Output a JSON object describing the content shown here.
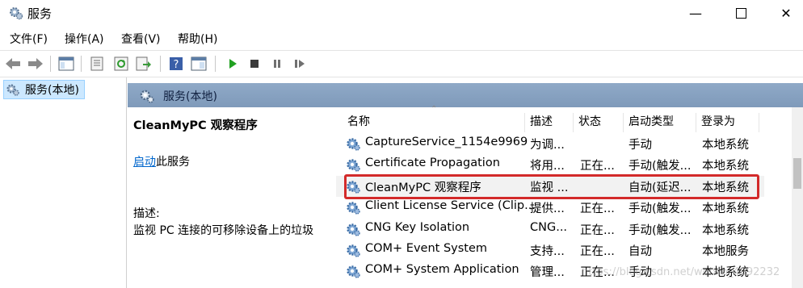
{
  "window": {
    "title": "服务"
  },
  "menu": [
    "文件(F)",
    "操作(A)",
    "查看(V)",
    "帮助(H)"
  ],
  "toolbar_icons": [
    "back-icon",
    "forward-icon",
    "show-hide-tree-icon",
    "properties-icon",
    "refresh-icon",
    "export-list-icon",
    "help-icon",
    "view-icon",
    "start-service-icon",
    "stop-service-icon",
    "pause-service-icon",
    "restart-service-icon"
  ],
  "tree": {
    "root": "服务(本地)"
  },
  "pane": {
    "header": "服务(本地)",
    "selected_name": "CleanMyPC 观察程序",
    "start_link": "启动",
    "start_suffix": "此服务",
    "desc_label": "描述:",
    "desc_text": "监视 PC 连接的可移除设备上的垃圾"
  },
  "columns": {
    "name": "名称",
    "desc": "描述",
    "status": "状态",
    "startup": "启动类型",
    "logon": "登录为"
  },
  "rows": [
    {
      "name": "CaptureService_1154e9969",
      "desc": "为调...",
      "status": "",
      "startup": "手动",
      "logon": "本地系统"
    },
    {
      "name": "Certificate Propagation",
      "desc": "将用...",
      "status": "正在...",
      "startup": "手动(触发...",
      "logon": "本地系统"
    },
    {
      "name": "CleanMyPC 观察程序",
      "desc": "监视 ...",
      "status": "",
      "startup": "自动(延迟...",
      "logon": "本地系统"
    },
    {
      "name": "Client License Service (Clip...",
      "desc": "提供...",
      "status": "正在...",
      "startup": "手动(触发...",
      "logon": "本地系统"
    },
    {
      "name": "CNG Key Isolation",
      "desc": "CNG...",
      "status": "正在...",
      "startup": "手动(触发...",
      "logon": "本地系统"
    },
    {
      "name": "COM+ Event System",
      "desc": "支持...",
      "status": "正在...",
      "startup": "自动",
      "logon": "本地服务"
    },
    {
      "name": "COM+ System Application",
      "desc": "管理...",
      "status": "正在...",
      "startup": "手动",
      "logon": "本地系统"
    }
  ],
  "watermark": "https://blog.csdn.net/weixin_4092232"
}
